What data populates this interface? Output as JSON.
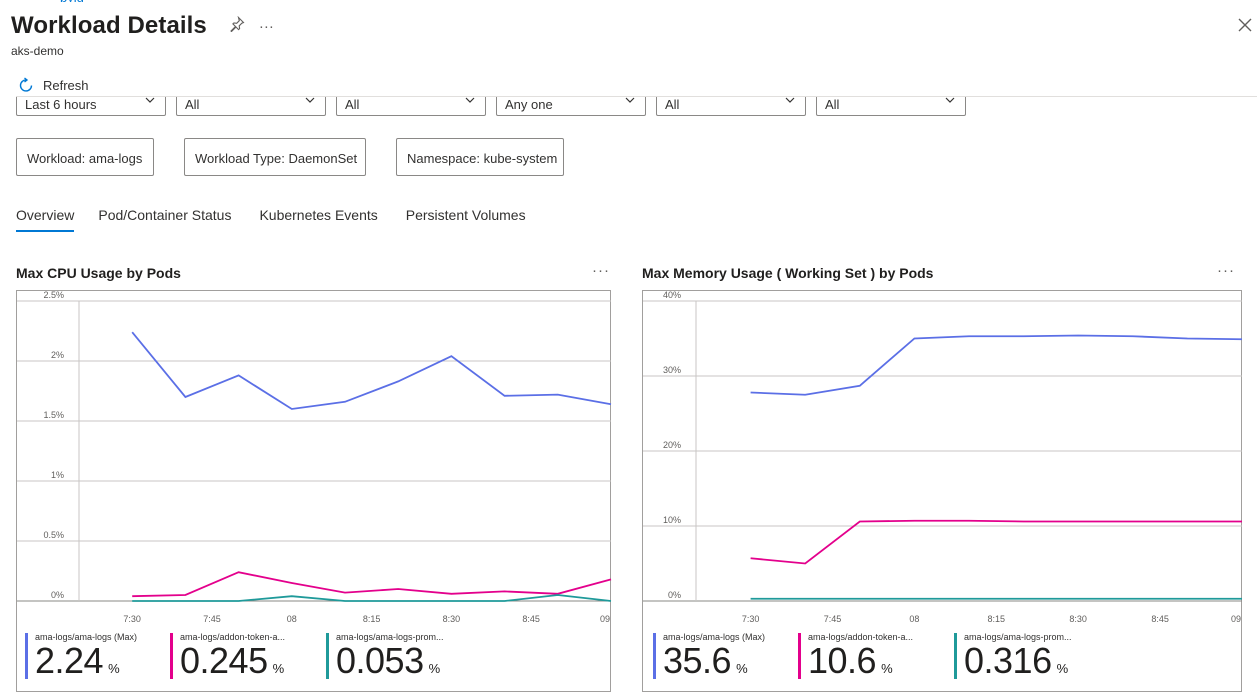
{
  "breadcrumb_fragment": "pyig",
  "header": {
    "title": "Workload Details",
    "subtitle": "aks-demo"
  },
  "toolbar": {
    "refresh_label": "Refresh"
  },
  "filters": [
    {
      "value": "Last 6 hours"
    },
    {
      "value": "All"
    },
    {
      "value": "All"
    },
    {
      "value": "Any one"
    },
    {
      "value": "All"
    },
    {
      "value": "All"
    }
  ],
  "pills": [
    {
      "label": "Workload: ama-logs"
    },
    {
      "label": "Workload Type: DaemonSet"
    },
    {
      "label": "Namespace: kube-system"
    }
  ],
  "tabs": [
    {
      "label": "Overview",
      "active": true
    },
    {
      "label": "Pod/Container Status",
      "active": false
    },
    {
      "label": "Kubernetes Events",
      "active": false
    },
    {
      "label": "Persistent Volumes",
      "active": false
    }
  ],
  "colors": {
    "accent": "#0078d4",
    "series1": "#5b6fe6",
    "series2": "#e3008c",
    "series3": "#1f9a9a"
  },
  "chart_data": [
    {
      "type": "line",
      "title": "Max CPU Usage by Pods",
      "x": [
        "7:20",
        "7:30",
        "7:40",
        "7:50",
        "08:00",
        "08:10",
        "08:20",
        "08:30",
        "08:40",
        "08:50",
        "09:00"
      ],
      "xticks": [
        "7:30",
        "7:45",
        "08",
        "8:15",
        "8:30",
        "8:45",
        "09"
      ],
      "ylim": [
        0,
        2.5
      ],
      "yticks": [
        "0%",
        "0.5%",
        "1%",
        "1.5%",
        "2%",
        "2.5%"
      ],
      "series": [
        {
          "name": "ama-logs/ama-logs (Max)",
          "values": [
            2.24,
            1.7,
            1.88,
            1.6,
            1.66,
            1.83,
            2.04,
            1.71,
            1.72,
            1.64
          ]
        },
        {
          "name": "ama-logs/addon-token-a...",
          "values": [
            0.04,
            0.05,
            0.24,
            0.15,
            0.07,
            0.1,
            0.06,
            0.08,
            0.06,
            0.18
          ]
        },
        {
          "name": "ama-logs/ama-logs-prom...",
          "values": [
            0.0,
            0.0,
            0.0,
            0.04,
            0.0,
            0.0,
            0.0,
            0.0,
            0.05,
            0.0
          ]
        }
      ],
      "legend": [
        {
          "name": "ama-logs/ama-logs (Max)",
          "value": "2.24",
          "unit": "%"
        },
        {
          "name": "ama-logs/addon-token-a...",
          "value": "0.245",
          "unit": "%"
        },
        {
          "name": "ama-logs/ama-logs-prom...",
          "value": "0.053",
          "unit": "%"
        }
      ]
    },
    {
      "type": "line",
      "title": "Max Memory Usage ( Working Set ) by Pods",
      "x": [
        "7:20",
        "7:30",
        "7:40",
        "7:50",
        "08:00",
        "08:10",
        "08:20",
        "08:30",
        "08:40",
        "08:50",
        "09:00"
      ],
      "xticks": [
        "7:30",
        "7:45",
        "08",
        "8:15",
        "8:30",
        "8:45",
        "09"
      ],
      "ylim": [
        0,
        40
      ],
      "yticks": [
        "0%",
        "10%",
        "20%",
        "30%",
        "40%"
      ],
      "series": [
        {
          "name": "ama-logs/ama-logs (Max)",
          "values": [
            27.8,
            27.5,
            28.7,
            35.0,
            35.3,
            35.3,
            35.4,
            35.3,
            35.0,
            34.9
          ]
        },
        {
          "name": "ama-logs/addon-token-a...",
          "values": [
            5.7,
            5.0,
            10.6,
            10.7,
            10.7,
            10.6,
            10.6,
            10.6,
            10.6,
            10.6
          ]
        },
        {
          "name": "ama-logs/ama-logs-prom...",
          "values": [
            0.3,
            0.3,
            0.3,
            0.3,
            0.3,
            0.3,
            0.3,
            0.3,
            0.3,
            0.3
          ]
        }
      ],
      "legend": [
        {
          "name": "ama-logs/ama-logs (Max)",
          "value": "35.6",
          "unit": "%"
        },
        {
          "name": "ama-logs/addon-token-a...",
          "value": "10.6",
          "unit": "%"
        },
        {
          "name": "ama-logs/ama-logs-prom...",
          "value": "0.316",
          "unit": "%"
        }
      ]
    }
  ]
}
